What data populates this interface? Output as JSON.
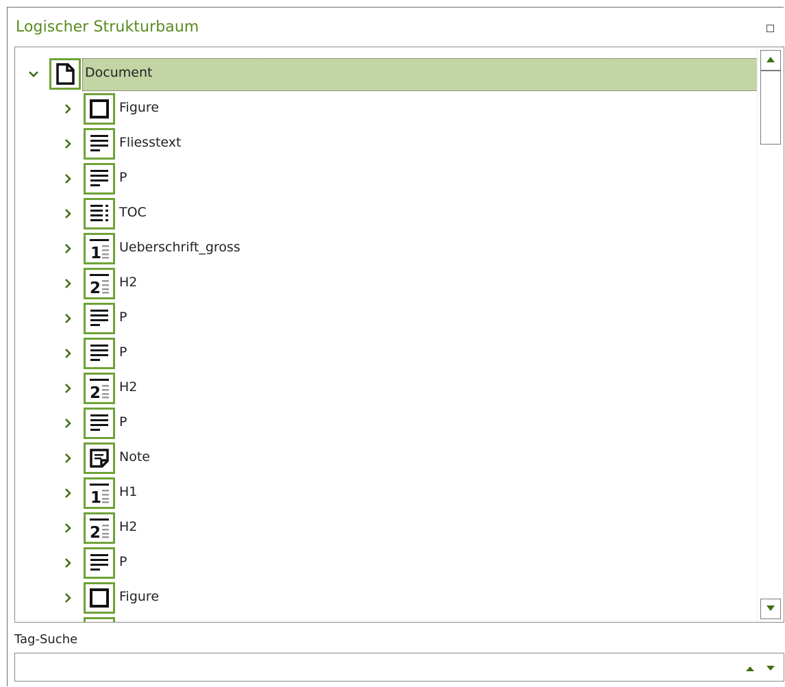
{
  "panel": {
    "title": "Logischer Strukturbaum"
  },
  "colors": {
    "accent": "#5a8a1e",
    "icon_border": "#6ea236",
    "selection": "#c4d5a5"
  },
  "tree": {
    "root": {
      "label": "Document",
      "icon": "document-icon",
      "expanded": true,
      "selected": true
    },
    "children": [
      {
        "label": "Figure",
        "icon": "figure-icon"
      },
      {
        "label": "Fliesstext",
        "icon": "paragraph-icon"
      },
      {
        "label": "P",
        "icon": "paragraph-icon"
      },
      {
        "label": "TOC",
        "icon": "toc-icon"
      },
      {
        "label": "Ueberschrift_gross",
        "icon": "heading1-icon"
      },
      {
        "label": "H2",
        "icon": "heading2-icon"
      },
      {
        "label": "P",
        "icon": "paragraph-icon"
      },
      {
        "label": "P",
        "icon": "paragraph-icon"
      },
      {
        "label": "H2",
        "icon": "heading2-icon"
      },
      {
        "label": "P",
        "icon": "paragraph-icon"
      },
      {
        "label": "Note",
        "icon": "note-icon"
      },
      {
        "label": "H1",
        "icon": "heading1-icon"
      },
      {
        "label": "H2",
        "icon": "heading2-icon"
      },
      {
        "label": "P",
        "icon": "paragraph-icon"
      },
      {
        "label": "Figure",
        "icon": "figure-icon"
      },
      {
        "label": "",
        "icon": "generic-icon"
      }
    ]
  },
  "search": {
    "label": "Tag-Suche",
    "value": "",
    "placeholder": ""
  }
}
